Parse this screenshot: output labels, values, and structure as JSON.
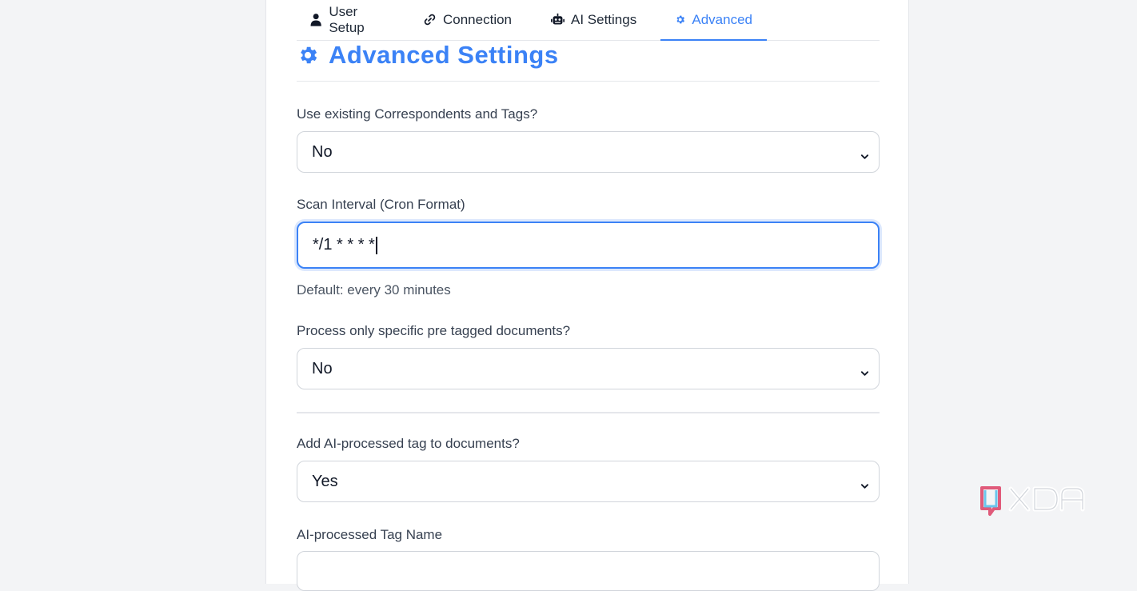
{
  "tabs": [
    {
      "label": "User Setup",
      "icon": "user-icon",
      "active": false
    },
    {
      "label": "Connection",
      "icon": "link-icon",
      "active": false
    },
    {
      "label": "AI Settings",
      "icon": "robot-icon",
      "active": false
    },
    {
      "label": "Advanced",
      "icon": "gear-icon",
      "active": true
    }
  ],
  "section": {
    "title": "Advanced Settings",
    "icon": "gear-icon"
  },
  "fields": {
    "use_existing": {
      "label": "Use existing Correspondents and Tags?",
      "value": "No"
    },
    "scan_interval": {
      "label": "Scan Interval (Cron Format)",
      "value": "*/1 * * * *",
      "help": "Default: every 30 minutes"
    },
    "pre_tagged": {
      "label": "Process only specific pre tagged documents?",
      "value": "No"
    },
    "add_ai_tag": {
      "label": "Add AI-processed tag to documents?",
      "value": "Yes"
    },
    "tag_name": {
      "label": "AI-processed Tag Name"
    }
  },
  "watermark": {
    "text": "XDA"
  },
  "colors": {
    "accent": "#3b82f6",
    "border": "#d1d5db",
    "text": "#111827"
  }
}
